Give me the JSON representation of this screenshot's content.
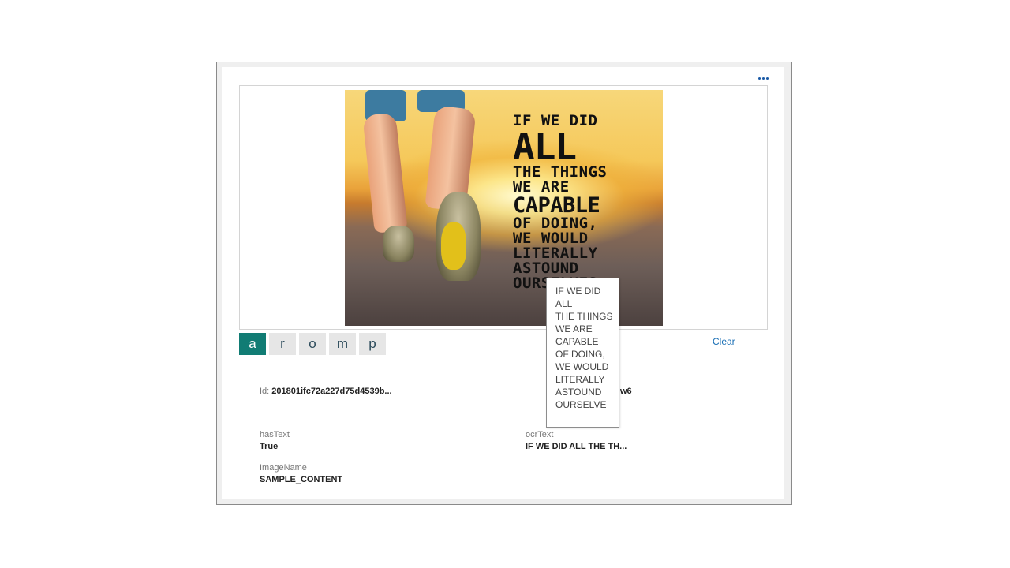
{
  "card": {
    "more_icon": "more-dots-icon",
    "image": {
      "quote_lines": [
        "IF WE DID",
        "ALL",
        "THE THINGS",
        "WE ARE",
        "CAPABLE",
        "OF DOING,",
        "WE WOULD",
        "LITERALLY",
        "ASTOUND",
        "OURSELVES."
      ]
    },
    "tabs": [
      "a",
      "r",
      "o",
      "m",
      "p"
    ],
    "active_tab": "a",
    "clear_label": "Clear"
  },
  "details": {
    "id_label": "Id:",
    "id_value": "201801ifc72a227d75d4539b...",
    "id_right_value": "w6",
    "has_text_label": "hasText",
    "has_text_value": "True",
    "ocr_text_label": "ocrText",
    "ocr_text_value": "IF WE DID ALL THE TH...",
    "image_name_label": "ImageName",
    "image_name_value": "SAMPLE_CONTENT"
  },
  "tooltip": {
    "lines": [
      "IF WE DID",
      "ALL",
      "THE THINGS",
      "WE ARE",
      "CAPABLE",
      "OF DOING,",
      "WE WOULD",
      "LITERALLY",
      "ASTOUND",
      "OURSELVE"
    ]
  },
  "colors": {
    "accent": "#117c74",
    "link": "#1a6fb5"
  }
}
